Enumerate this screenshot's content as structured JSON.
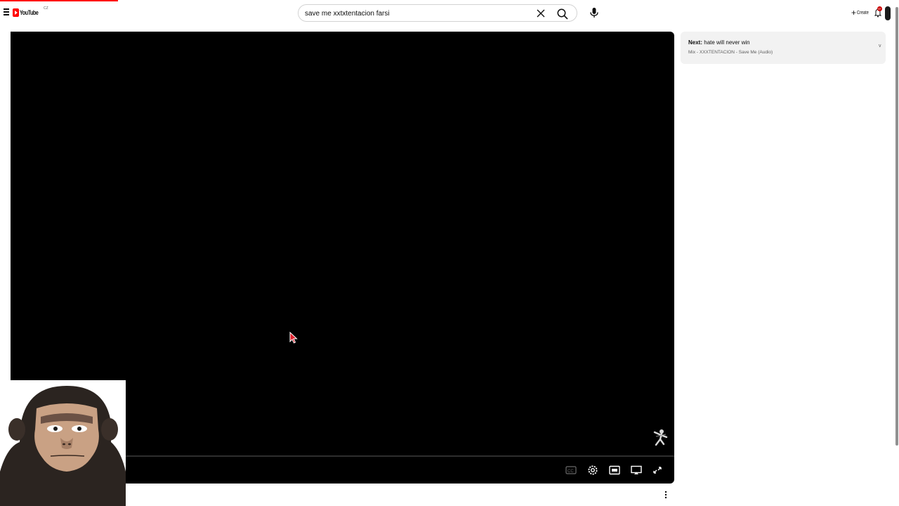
{
  "header": {
    "logo_text": "YouTube",
    "logo_sup": "CZ",
    "search_value": "save me xxtxtentacion farsi",
    "create_label": "Create",
    "create_plus": "+",
    "notification_count": "9+"
  },
  "up_next": {
    "prefix": "Next:",
    "title": "hate will never win",
    "subtitle": "Mix - XXXTENTACION - Save Me (Audio)",
    "chevron": "v"
  },
  "player": {
    "controls": [
      "subtitles-icon",
      "settings-icon",
      "miniplayer-icon",
      "cast-icon",
      "fullscreen-icon"
    ]
  },
  "colors": {
    "brand": "#ff0000",
    "player_bg": "#000000",
    "upnext_bg": "#f2f2f2"
  }
}
